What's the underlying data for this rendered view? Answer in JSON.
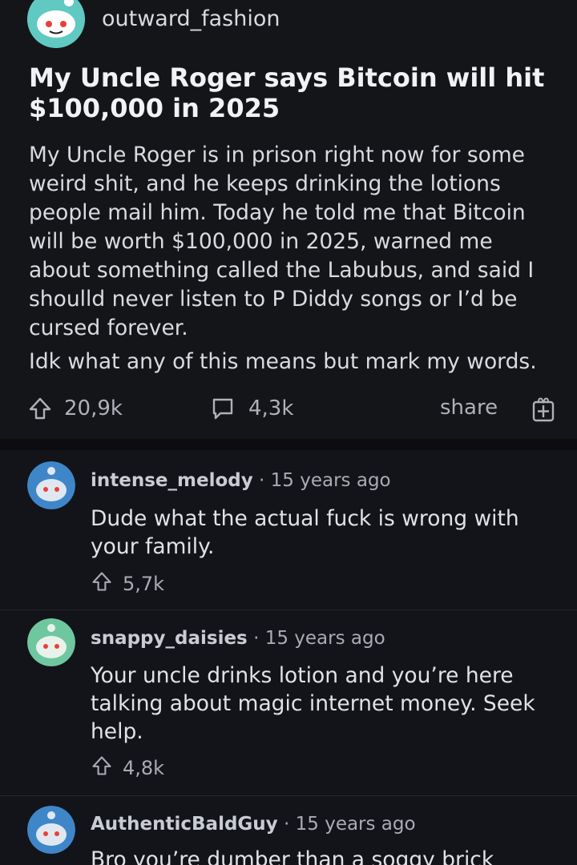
{
  "post": {
    "username": "outward_fashion",
    "title": "My Uncle Roger says Bitcoin will hit $100,000 in 2025",
    "body": "My Uncle Roger is in prison right now for some weird shit, and he keeps drinking the lotions people mail him. Today he told me that Bitcoin will be worth $100,000 in 2025, warned me about something called the Labubus, and said I shoulld never listen to P Diddy songs or I’d be cursed forever.",
    "body2": "Idk what any of this means but mark my words.",
    "upvotes": "20,9k",
    "comments": "4,3k",
    "share_label": "share"
  },
  "comments": [
    {
      "username": "intense_melody",
      "time": "15 years ago",
      "text": "Dude what the actual fuck is wrong with your family.",
      "votes": "5,7k",
      "avatar_color": "#3f86c9"
    },
    {
      "username": "snappy_daisies",
      "time": "15 years ago",
      "text": "Your uncle drinks lotion and you’re here talking about magic internet money. Seek help.",
      "votes": "4,8k",
      "avatar_color": "#6fc7a0"
    },
    {
      "username": "AuthenticBaldGuy",
      "time": "15 years ago",
      "text": "Bro you’re dumber than a soggy brick",
      "avatar_color": "#3f86c9"
    }
  ],
  "icons": {
    "upvote": "arrow-up-icon",
    "comment": "speech-bubble-icon",
    "award": "gift-box-icon"
  }
}
